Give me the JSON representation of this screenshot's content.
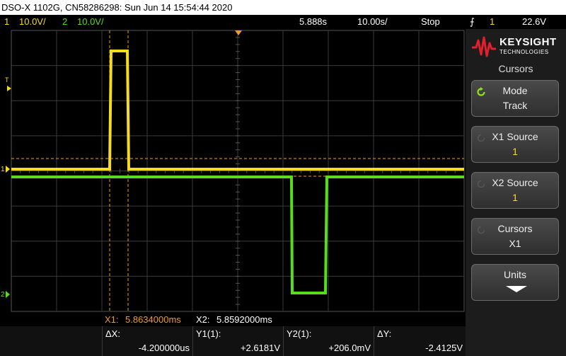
{
  "title": "DSO-X 1102G, CN58286298: Sun Jun 14 15:54:44 2020",
  "status": {
    "ch1_num": "1",
    "ch1_scale": "10.0V/",
    "ch2_num": "2",
    "ch2_scale": "10.0V/",
    "time_delay": "5.888s",
    "time_scale": "10.00s/",
    "run_state": "Stop",
    "trig_slope": "⨍",
    "trig_src": "1",
    "trig_level": "22.6V"
  },
  "plot": {
    "trigger_marker": "T",
    "ch1_ground_marker": "1",
    "ch2_ground_marker": "2"
  },
  "cursors_readout": {
    "x1_label": "X1:",
    "x1_value": "5.8634000ms",
    "x2_label": "X2:",
    "x2_value": "5.8592000ms"
  },
  "measurements": [
    {
      "label": "ΔX:",
      "value": "-4.200000us"
    },
    {
      "label": "Y1(1):",
      "value": "+2.6181V"
    },
    {
      "label": "Y2(1):",
      "value": "+206.0mV"
    },
    {
      "label": "ΔY:",
      "value": "-2.4125V"
    }
  ],
  "sidebar": {
    "brand_name": "KEYSIGHT",
    "brand_sub": "TECHNOLOGIES",
    "menu_title": "Cursors",
    "softkeys": [
      {
        "label": "Mode",
        "value": "Track"
      },
      {
        "label": "X1 Source",
        "value": "1"
      },
      {
        "label": "X2 Source",
        "value": "1"
      },
      {
        "label": "Cursors",
        "value": "X1"
      },
      {
        "label": "Units",
        "value": ""
      }
    ]
  },
  "colors": {
    "ch1": "#f5dc1e",
    "ch2": "#5adc1e",
    "cursor": "#f39c1e",
    "grid": "#3c3c3c"
  }
}
